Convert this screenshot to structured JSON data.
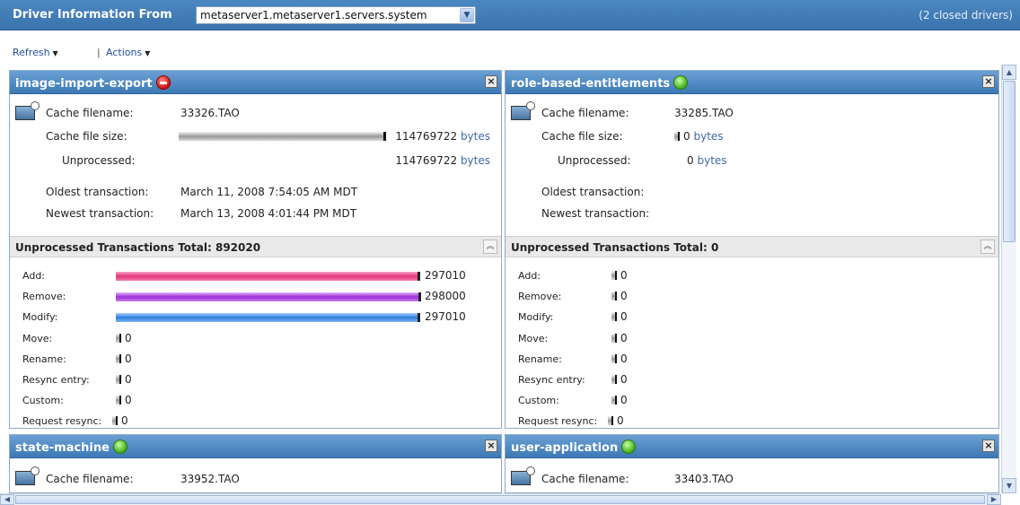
{
  "header": {
    "title": "Driver Information From",
    "server": "metaserver1.metaserver1.servers.system",
    "closed_drivers": "(2 closed drivers)"
  },
  "toolbar": {
    "refresh": "Refresh",
    "separator": "|",
    "actions": "Actions"
  },
  "labels": {
    "cache_filename": "Cache filename:",
    "cache_file_size": "Cache file size:",
    "unprocessed": "Unprocessed:",
    "oldest": "Oldest transaction:",
    "newest": "Newest transaction:",
    "bytes": "bytes",
    "add": "Add:",
    "remove": "Remove:",
    "modify": "Modify:",
    "move": "Move:",
    "rename": "Rename:",
    "resync_entry": "Resync entry:",
    "custom": "Custom:",
    "request_resync": "Request resync:"
  },
  "panels": [
    {
      "name": "image-import-export",
      "status": "stopped",
      "cache_filename": "33326.TAO",
      "cache_file_size": "114769722",
      "unprocessed": "114769722",
      "oldest": "March 11, 2008 7:54:05 AM MDT",
      "newest": "March 13, 2008 4:01:44 PM MDT",
      "total_label": "Unprocessed Transactions Total: 892020",
      "tx": {
        "add": "297010",
        "remove": "298000",
        "modify": "297010",
        "move": "0",
        "rename": "0",
        "resync_entry": "0",
        "custom": "0",
        "request_resync": "0"
      }
    },
    {
      "name": "role-based-entitlements",
      "status": "running",
      "cache_filename": "33285.TAO",
      "cache_file_size": "0",
      "unprocessed": "0",
      "oldest": "",
      "newest": "",
      "total_label": "Unprocessed Transactions Total: 0",
      "tx": {
        "add": "0",
        "remove": "0",
        "modify": "0",
        "move": "0",
        "rename": "0",
        "resync_entry": "0",
        "custom": "0",
        "request_resync": "0"
      }
    },
    {
      "name": "state-machine",
      "status": "running",
      "cache_filename": "33952.TAO"
    },
    {
      "name": "user-application",
      "status": "running",
      "cache_filename": "33403.TAO"
    }
  ],
  "colors": {
    "header_blue": "#3a73ad",
    "add": "#e0357c",
    "remove": "#9b2ed6",
    "modify": "#2c7de0"
  }
}
